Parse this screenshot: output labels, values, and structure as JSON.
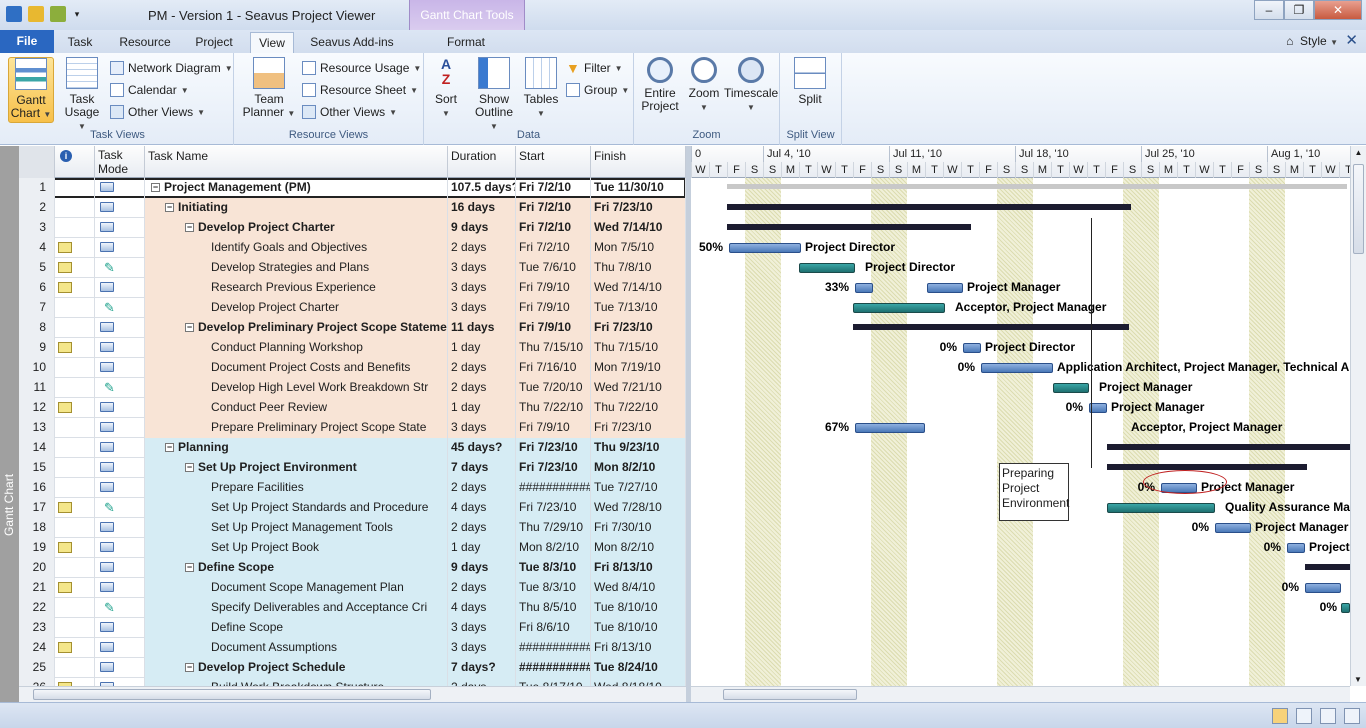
{
  "window": {
    "title": "PM - Version 1 - Seavus Project Viewer",
    "context_tab": "Gantt Chart Tools"
  },
  "tabs": {
    "file": "File",
    "task": "Task",
    "resource": "Resource",
    "project": "Project",
    "view": "View",
    "addins": "Seavus Add-ins",
    "format": "Format"
  },
  "style_label": "Style",
  "ribbon": {
    "task_views": {
      "label": "Task Views",
      "gantt": "Gantt Chart",
      "task_usage": "Task Usage",
      "network": "Network Diagram",
      "calendar": "Calendar",
      "other": "Other Views"
    },
    "resource_views": {
      "label": "Resource Views",
      "team_planner": "Team Planner",
      "usage": "Resource Usage",
      "sheet": "Resource Sheet",
      "other": "Other Views"
    },
    "data": {
      "label": "Data",
      "sort": "Sort",
      "outline": "Show Outline",
      "tables": "Tables",
      "filter": "Filter",
      "group": "Group"
    },
    "zoom": {
      "label": "Zoom",
      "entire": "Entire Project",
      "zoom": "Zoom",
      "timescale": "Timescale"
    },
    "split": {
      "label": "Split View",
      "split": "Split"
    }
  },
  "side_label": "Gantt Chart",
  "columns": {
    "mode": "Task Mode",
    "name": "Task Name",
    "duration": "Duration",
    "start": "Start",
    "finish": "Finish"
  },
  "rows": [
    {
      "id": "1",
      "name": "Project Management (PM)",
      "dur": "107.5 days?",
      "start": "Fri 7/2/10",
      "fin": "Tue 11/30/10"
    },
    {
      "id": "2",
      "name": "Initiating",
      "dur": "16 days",
      "start": "Fri 7/2/10",
      "fin": "Fri 7/23/10"
    },
    {
      "id": "3",
      "name": "Develop Project Charter",
      "dur": "9 days",
      "start": "Fri 7/2/10",
      "fin": "Wed 7/14/10"
    },
    {
      "id": "4",
      "name": "Identify Goals and Objectives",
      "dur": "2 days",
      "start": "Fri 7/2/10",
      "fin": "Mon 7/5/10"
    },
    {
      "id": "5",
      "name": "Develop Strategies and Plans",
      "dur": "3 days",
      "start": "Tue 7/6/10",
      "fin": "Thu 7/8/10"
    },
    {
      "id": "6",
      "name": "Research Previous Experience",
      "dur": "3 days",
      "start": "Fri 7/9/10",
      "fin": "Wed 7/14/10"
    },
    {
      "id": "7",
      "name": "Develop Project Charter",
      "dur": "3 days",
      "start": "Fri 7/9/10",
      "fin": "Tue 7/13/10"
    },
    {
      "id": "8",
      "name": "Develop Preliminary Project Scope Stateme",
      "dur": "11 days",
      "start": "Fri 7/9/10",
      "fin": "Fri 7/23/10"
    },
    {
      "id": "9",
      "name": "Conduct Planning Workshop",
      "dur": "1 day",
      "start": "Thu 7/15/10",
      "fin": "Thu 7/15/10"
    },
    {
      "id": "10",
      "name": "Document Project Costs and Benefits",
      "dur": "2 days",
      "start": "Fri 7/16/10",
      "fin": "Mon 7/19/10"
    },
    {
      "id": "11",
      "name": "Develop High Level Work Breakdown Str",
      "dur": "2 days",
      "start": "Tue 7/20/10",
      "fin": "Wed 7/21/10"
    },
    {
      "id": "12",
      "name": "Conduct Peer Review",
      "dur": "1 day",
      "start": "Thu 7/22/10",
      "fin": "Thu 7/22/10"
    },
    {
      "id": "13",
      "name": "Prepare Preliminary Project Scope State",
      "dur": "3 days",
      "start": "Fri 7/9/10",
      "fin": "Fri 7/23/10"
    },
    {
      "id": "14",
      "name": "Planning",
      "dur": "45 days?",
      "start": "Fri 7/23/10",
      "fin": "Thu 9/23/10"
    },
    {
      "id": "15",
      "name": "Set Up Project Environment",
      "dur": "7 days",
      "start": "Fri 7/23/10",
      "fin": "Mon 8/2/10"
    },
    {
      "id": "16",
      "name": "Prepare Facilities",
      "dur": "2 days",
      "start": "############",
      "fin": "Tue 7/27/10"
    },
    {
      "id": "17",
      "name": "Set Up Project Standards and Procedure",
      "dur": "4 days",
      "start": "Fri 7/23/10",
      "fin": "Wed 7/28/10"
    },
    {
      "id": "18",
      "name": "Set Up Project Management Tools",
      "dur": "2 days",
      "start": "Thu 7/29/10",
      "fin": "Fri 7/30/10"
    },
    {
      "id": "19",
      "name": "Set Up Project Book",
      "dur": "1 day",
      "start": "Mon 8/2/10",
      "fin": "Mon 8/2/10"
    },
    {
      "id": "20",
      "name": "Define Scope",
      "dur": "9 days",
      "start": "Tue 8/3/10",
      "fin": "Fri 8/13/10"
    },
    {
      "id": "21",
      "name": "Document Scope Management Plan",
      "dur": "2 days",
      "start": "Tue 8/3/10",
      "fin": "Wed 8/4/10"
    },
    {
      "id": "22",
      "name": "Specify Deliverables and Acceptance Cri",
      "dur": "4 days",
      "start": "Thu 8/5/10",
      "fin": "Tue 8/10/10"
    },
    {
      "id": "23",
      "name": "Define Scope",
      "dur": "3 days",
      "start": "Fri 8/6/10",
      "fin": "Tue 8/10/10"
    },
    {
      "id": "24",
      "name": "Document Assumptions",
      "dur": "3 days",
      "start": "############",
      "fin": "Fri 8/13/10"
    },
    {
      "id": "25",
      "name": "Develop Project Schedule",
      "dur": "7 days?",
      "start": "############",
      "fin": "Tue 8/24/10"
    },
    {
      "id": "26",
      "name": "Build Work Breakdown Structure",
      "dur": "2 days",
      "start": "Tue 8/17/10",
      "fin": "Wed 8/18/10"
    }
  ],
  "timescale": {
    "weeks": [
      "0",
      "Jul 4, '10",
      "Jul 11, '10",
      "Jul 18, '10",
      "Jul 25, '10",
      "Aug 1, '10"
    ],
    "days": [
      "W",
      "T",
      "F",
      "S",
      "S",
      "M",
      "T",
      "W",
      "T",
      "F",
      "S",
      "S",
      "M",
      "T",
      "W",
      "T",
      "F",
      "S",
      "S",
      "M",
      "T",
      "W",
      "T",
      "F",
      "S",
      "S",
      "M",
      "T",
      "W",
      "T",
      "F",
      "S",
      "S",
      "M",
      "T",
      "W",
      "T"
    ]
  },
  "gantt_labels": {
    "l4": "Project Director",
    "p4": "50%",
    "l5": "Project Director",
    "l6": "Project Manager",
    "p6": "33%",
    "l7": "Acceptor, Project Manager",
    "l9": "Project Director",
    "p9": "0%",
    "l10": "Application Architect, Project Manager, Technical Arch",
    "p10": "0%",
    "l11": "Project Manager",
    "l12": "Project Manager",
    "p12": "0%",
    "l13": "Acceptor, Project Manager",
    "p13": "67%",
    "l16": "Project Manager",
    "p16": "0%",
    "l17": "Quality Assurance Man",
    "l18": "Project Manager",
    "p18": "0%",
    "l19": "Project",
    "p19": "0%",
    "p21": "0%",
    "p22": "0%",
    "annotation": "Preparing Project Environment"
  },
  "colors": {
    "accent": "#2a67c1",
    "summary_bar": "#1c1c30",
    "task_bar": "#4a78b8",
    "critical_bar": "#3aa6a6",
    "pink_row": "#f8e4d6",
    "blue_row": "#d6ecf4"
  }
}
